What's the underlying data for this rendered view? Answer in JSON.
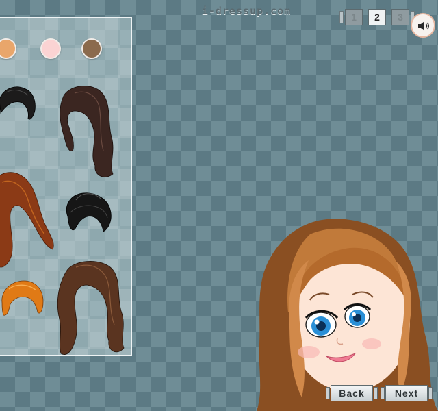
{
  "header": {
    "site_logo": "i-dressup.com"
  },
  "pager": {
    "pages": [
      "1",
      "2",
      "3"
    ],
    "current": "2"
  },
  "sound": {
    "icon": "speaker-icon"
  },
  "panel": {
    "skin_tones": [
      {
        "name": "skin-tone-tan",
        "color": "#e9a66b"
      },
      {
        "name": "skin-tone-pink",
        "color": "#fbd3d3"
      },
      {
        "name": "skin-tone-brown",
        "color": "#8b6a4c"
      }
    ],
    "hair_styles": [
      {
        "name": "hair-black-short",
        "color": "#1c1b1b"
      },
      {
        "name": "hair-dark-brown-long-wavy",
        "color": "#3b2621"
      },
      {
        "name": "hair-auburn-long",
        "color": "#8b3a16"
      },
      {
        "name": "hair-black-updo",
        "color": "#161616"
      },
      {
        "name": "hair-orange-bob",
        "color": "#e07a16"
      },
      {
        "name": "hair-brown-long-wavy",
        "color": "#5a3420"
      }
    ]
  },
  "navigation": {
    "back_label": "Back",
    "next_label": "Next"
  },
  "colors": {
    "background": "#6f8d96",
    "diamond": "#5c7a84",
    "button_face": "#e4e9eb"
  }
}
